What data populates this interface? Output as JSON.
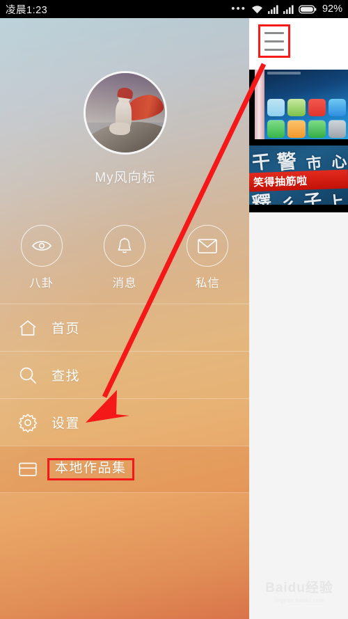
{
  "status_bar": {
    "time": "凌晨1:23",
    "dots": "•••",
    "battery_percent": "92%",
    "icons": [
      "more-dots-icon",
      "wifi-icon",
      "signal-icon",
      "signal-icon",
      "battery-icon"
    ]
  },
  "drawer": {
    "profile": {
      "avatar_alt": "user-avatar",
      "username": "My风向标"
    },
    "quick_actions": [
      {
        "label": "八卦",
        "icon": "eye-icon"
      },
      {
        "label": "消息",
        "icon": "bell-icon"
      },
      {
        "label": "私信",
        "icon": "envelope-icon"
      }
    ],
    "menu_items": [
      {
        "label": "首页",
        "icon": "home-icon",
        "active": false
      },
      {
        "label": "查找",
        "icon": "search-icon",
        "active": false
      },
      {
        "label": "设置",
        "icon": "gear-icon",
        "active": false
      },
      {
        "label": "本地作品集",
        "icon": "folder-icon",
        "active": true
      }
    ]
  },
  "content": {
    "menu_button": {
      "icon": "hamburger-icon",
      "label": ""
    },
    "thumbnails": [
      {
        "name": "phone-homescreen-screenshot",
        "caption": ""
      },
      {
        "name": "calligraphy-video-thumbnail",
        "caption": "笑得抽筋啦"
      }
    ]
  },
  "watermark": {
    "line1": "Baidu经验",
    "line2": "jingyan.baidu.com"
  },
  "annotations": {
    "highlight_boxes": [
      "hamburger-icon",
      "本地作品集"
    ],
    "arrow_color": "#f41818"
  }
}
